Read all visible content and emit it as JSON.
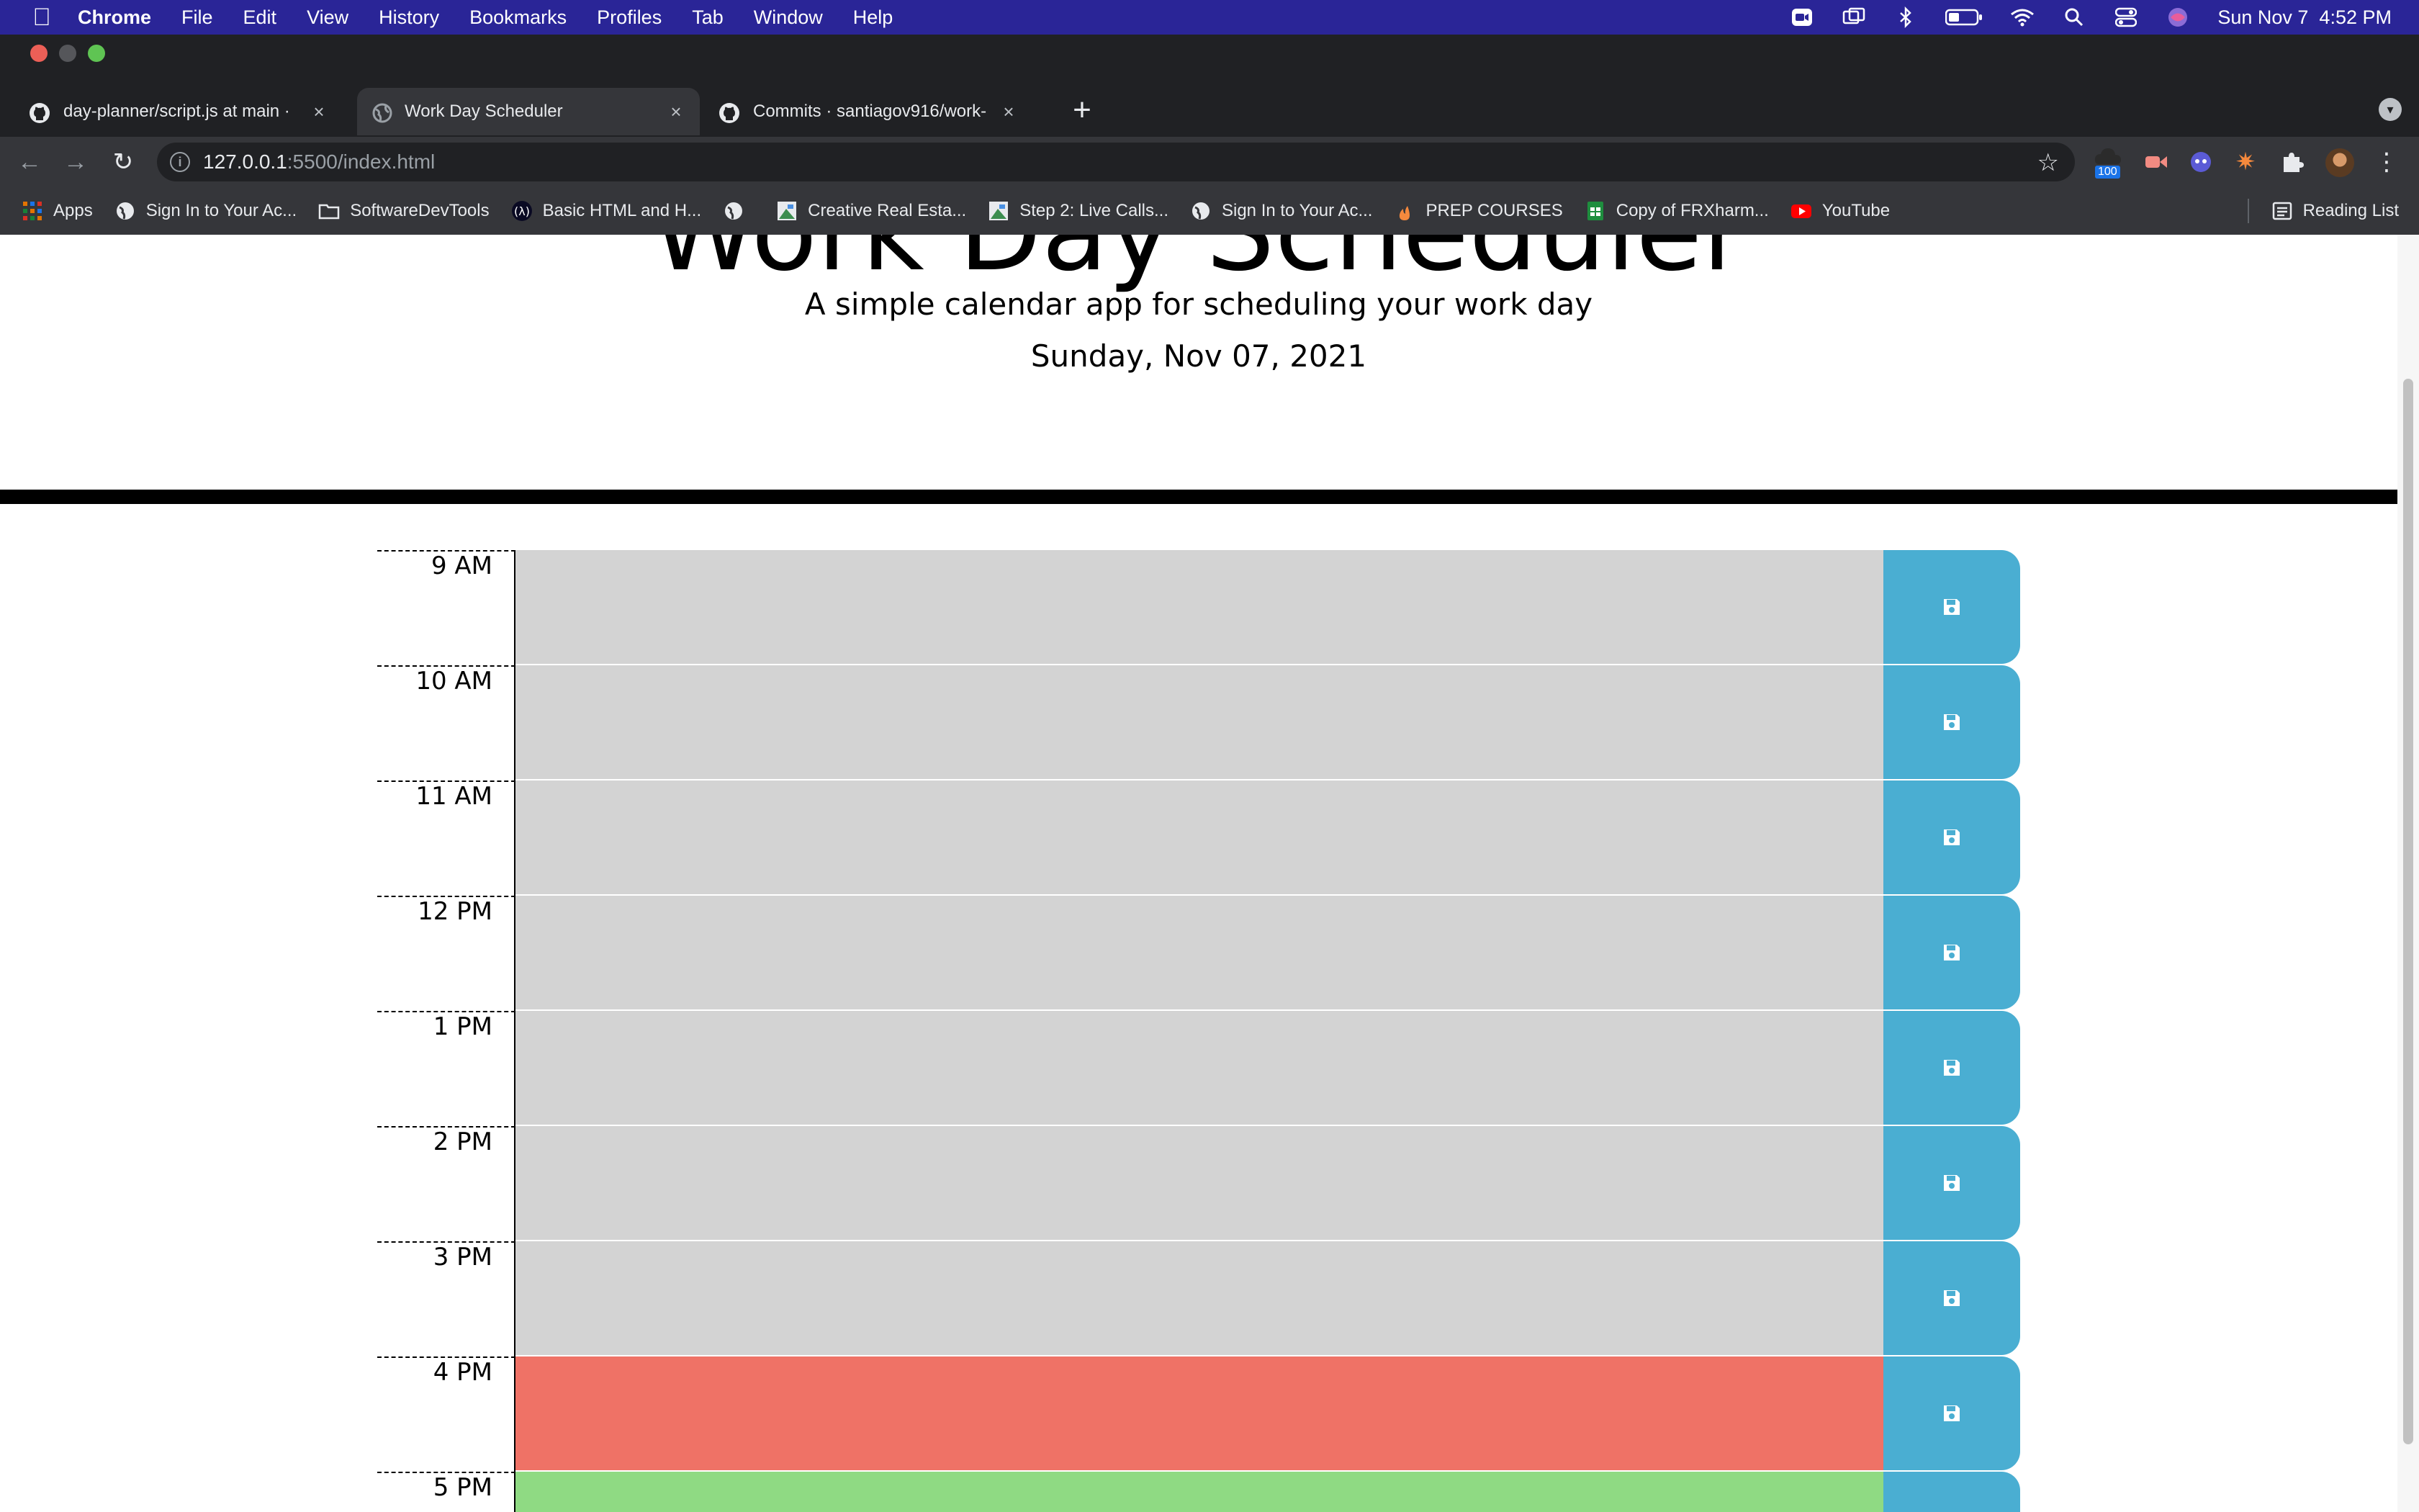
{
  "menubar": {
    "app": "Chrome",
    "items": [
      "File",
      "Edit",
      "View",
      "History",
      "Bookmarks",
      "Profiles",
      "Tab",
      "Window",
      "Help"
    ],
    "clock": "Sun Nov 7  4:52 PM"
  },
  "tabs": [
    {
      "title": "day-planner/script.js at main ·",
      "icon": "github-icon"
    },
    {
      "title": "Work Day Scheduler",
      "icon": "globe-icon"
    },
    {
      "title": "Commits · santiagov916/work-",
      "icon": "github-icon"
    }
  ],
  "address": {
    "host": "127.0.0.1",
    "rest": ":5500/index.html"
  },
  "bookmarks": [
    {
      "label": "Apps"
    },
    {
      "label": "Sign In to Your Ac..."
    },
    {
      "label": "SoftwareDevTools"
    },
    {
      "label": "Basic HTML and H..."
    },
    {
      "label": "Creative Real Esta..."
    },
    {
      "label": "Step 2: Live Calls..."
    },
    {
      "label": "Sign In to Your Ac..."
    },
    {
      "label": "PREP COURSES"
    },
    {
      "label": "Copy of FRXharm..."
    },
    {
      "label": "YouTube"
    }
  ],
  "reading_list": "Reading List",
  "extension_badge": "100",
  "page": {
    "title": "Work Day Scheduler",
    "tagline": "A simple calendar app for scheduling your work day",
    "current_day": "Sunday, Nov 07, 2021"
  },
  "schedule": [
    {
      "hour": "9 AM",
      "state": "past",
      "text": ""
    },
    {
      "hour": "10 AM",
      "state": "past",
      "text": ""
    },
    {
      "hour": "11 AM",
      "state": "past",
      "text": ""
    },
    {
      "hour": "12 PM",
      "state": "past",
      "text": ""
    },
    {
      "hour": "1 PM",
      "state": "past",
      "text": ""
    },
    {
      "hour": "2 PM",
      "state": "past",
      "text": ""
    },
    {
      "hour": "3 PM",
      "state": "past",
      "text": ""
    },
    {
      "hour": "4 PM",
      "state": "present",
      "text": ""
    },
    {
      "hour": "5 PM",
      "state": "future",
      "text": ""
    }
  ],
  "colors": {
    "past": "#d3d3d3",
    "present": "#ef7266",
    "future": "#8fda83",
    "save": "#4aaed2",
    "menubar": "#2a2597"
  }
}
